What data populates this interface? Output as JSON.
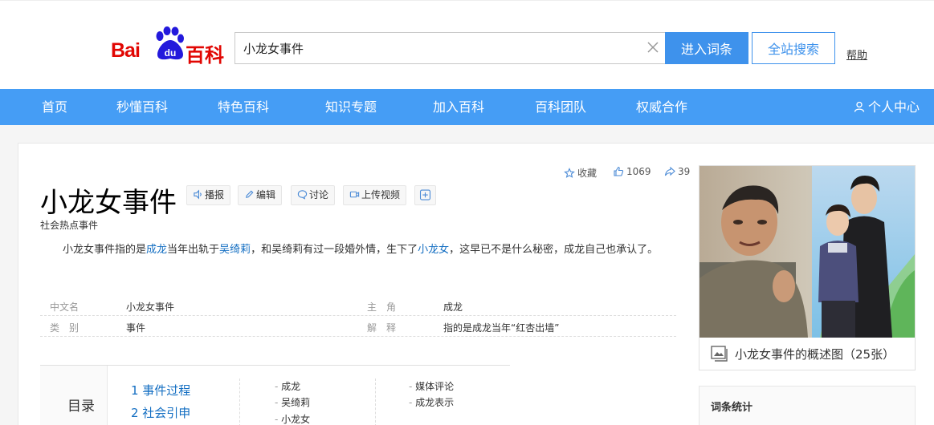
{
  "header": {
    "logo_text_left": "Bai",
    "logo_text_paw": "du",
    "logo_text_right": "百科",
    "search_value": "小龙女事件",
    "enter_button": "进入词条",
    "all_search_button": "全站搜索",
    "help": "帮助"
  },
  "nav": {
    "items": [
      "首页",
      "秒懂百科",
      "特色百科",
      "知识专题",
      "加入百科",
      "百科团队",
      "权威合作"
    ],
    "user": "个人中心"
  },
  "entry": {
    "title": "小龙女事件",
    "tools": [
      "播报",
      "编辑",
      "讨论",
      "上传视频"
    ],
    "collect": "收藏",
    "likes": "1069",
    "shares": "39",
    "subtitle": "社会热点事件",
    "summary": {
      "p1": "小龙女事件指的是",
      "link1": "成龙",
      "p2": "当年出轨于",
      "link2": "吴绮莉",
      "p3": "，和吴绮莉有过一段婚外情，生下了",
      "link3": "小龙女",
      "p4": "，这早已不是什么秘密，成龙自己也承认了。"
    },
    "info": [
      {
        "k1": "中文名",
        "v1": "小龙女事件",
        "k2": "主　角",
        "v2": "成龙"
      },
      {
        "k1": "类　别",
        "v1": "事件",
        "k2": "解　释",
        "v2": "指的是成龙当年“红杏出墙”"
      }
    ]
  },
  "toc": {
    "title": "目录",
    "main": [
      "1  事件过程",
      "2  社会引申"
    ],
    "col1": [
      "成龙",
      "吴绮莉",
      "小龙女"
    ],
    "col2": [
      "媒体评论",
      "成龙表示"
    ]
  },
  "album": {
    "caption": "小龙女事件的概述图（25张）"
  },
  "stats_box": {
    "title": "词条统计"
  },
  "colors": {
    "brand_red": "#e10602",
    "nav_blue": "#459df5",
    "button_blue": "#3e92ec",
    "link_blue": "#136ec2"
  }
}
